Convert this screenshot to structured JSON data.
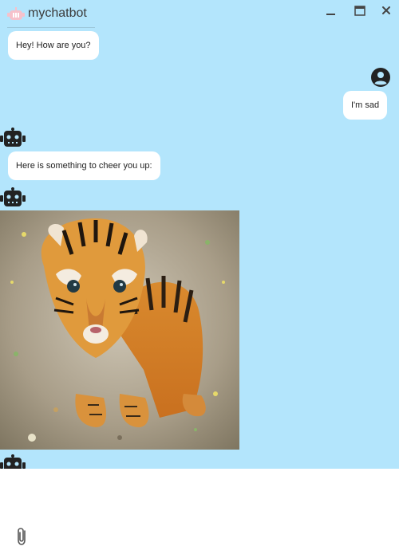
{
  "window": {
    "title": "mychatbot"
  },
  "messages": [
    {
      "sender": "bot",
      "text": "Hey! How are you?"
    },
    {
      "sender": "user",
      "text": "I'm sad"
    },
    {
      "sender": "bot",
      "text": "Here is something to cheer you up:"
    },
    {
      "sender": "bot",
      "type": "image",
      "subject": "tiger cub"
    }
  ],
  "input": {
    "icon": "paperclip-icon"
  },
  "colors": {
    "chat_background": "#b3e5fc",
    "bubble": "#ffffff",
    "icon_dark": "#222222"
  }
}
